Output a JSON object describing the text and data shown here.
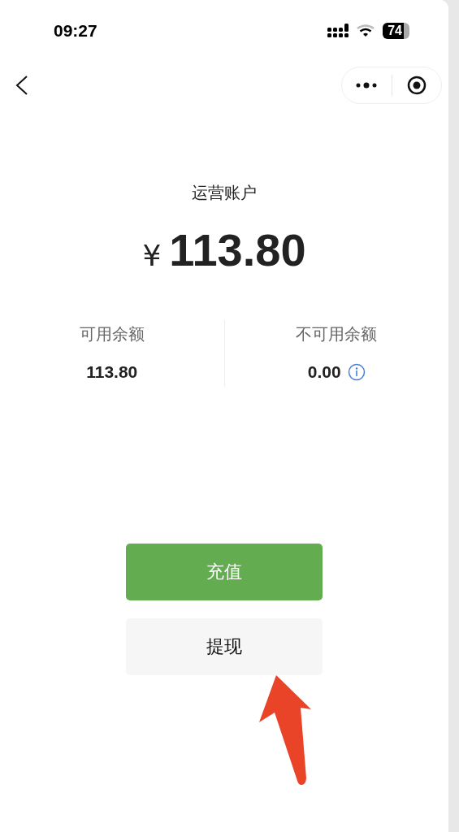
{
  "status_bar": {
    "time": "09:27",
    "battery": "74"
  },
  "account": {
    "title": "运营账户",
    "currency": "¥",
    "total": "113.80"
  },
  "balances": [
    {
      "label": "可用余额",
      "value": "113.80",
      "info": false
    },
    {
      "label": "不可用余额",
      "value": "0.00",
      "info": true
    }
  ],
  "buttons": [
    {
      "label": "充值",
      "kind": "primary"
    },
    {
      "label": "提现",
      "kind": "secondary"
    }
  ]
}
